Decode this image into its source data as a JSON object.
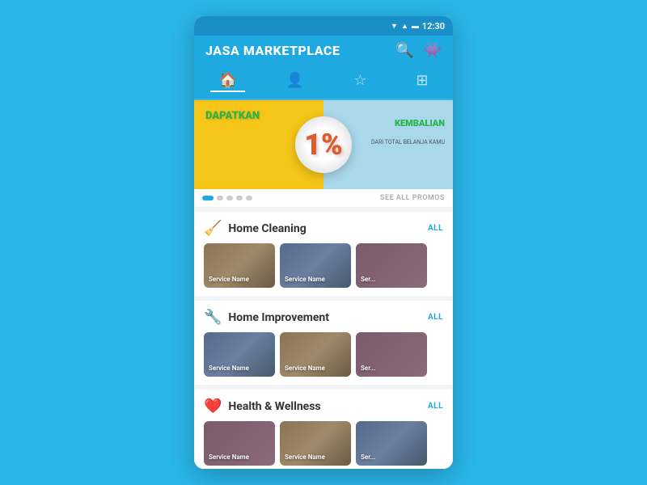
{
  "app": {
    "title": "JASA MARKETPLACE",
    "status_time": "12:30"
  },
  "nav": {
    "tabs": [
      {
        "label": "🏠",
        "name": "home",
        "active": true
      },
      {
        "label": "👤",
        "name": "profile",
        "active": false
      },
      {
        "label": "☆",
        "name": "favorites",
        "active": false
      },
      {
        "label": "⊞",
        "name": "layers",
        "active": false
      }
    ]
  },
  "promo": {
    "banner_text_1": "DAPATKAN",
    "banner_percent": "1%",
    "banner_text_2": "KEMBALIAN",
    "banner_text_3": "DARI TOTAL BELANJA KAMU",
    "see_all_label": "SEE ALL PROMOS",
    "dots": [
      {
        "active": true
      },
      {
        "active": false
      },
      {
        "active": false
      },
      {
        "active": false
      },
      {
        "active": false
      }
    ]
  },
  "sections": [
    {
      "id": "home-cleaning",
      "icon": "🧹",
      "title": "Home Cleaning",
      "all_label": "ALL",
      "cards": [
        {
          "label": "Service Name",
          "bg_class": "card-bg-1"
        },
        {
          "label": "Service Name",
          "bg_class": "card-bg-2"
        },
        {
          "label": "Ser...",
          "bg_class": "card-bg-3"
        }
      ]
    },
    {
      "id": "home-improvement",
      "icon": "🔧",
      "title": "Home Improvement",
      "all_label": "ALL",
      "cards": [
        {
          "label": "Service Name",
          "bg_class": "card-bg-2"
        },
        {
          "label": "Service Name",
          "bg_class": "card-bg-1"
        },
        {
          "label": "Ser...",
          "bg_class": "card-bg-3"
        }
      ]
    },
    {
      "id": "health-wellness",
      "icon": "❤️",
      "title": "Health & Wellness",
      "all_label": "ALL",
      "cards": [
        {
          "label": "Service Name",
          "bg_class": "card-bg-3"
        },
        {
          "label": "Service Name",
          "bg_class": "card-bg-1"
        },
        {
          "label": "Ser...",
          "bg_class": "card-bg-2"
        }
      ]
    }
  ]
}
